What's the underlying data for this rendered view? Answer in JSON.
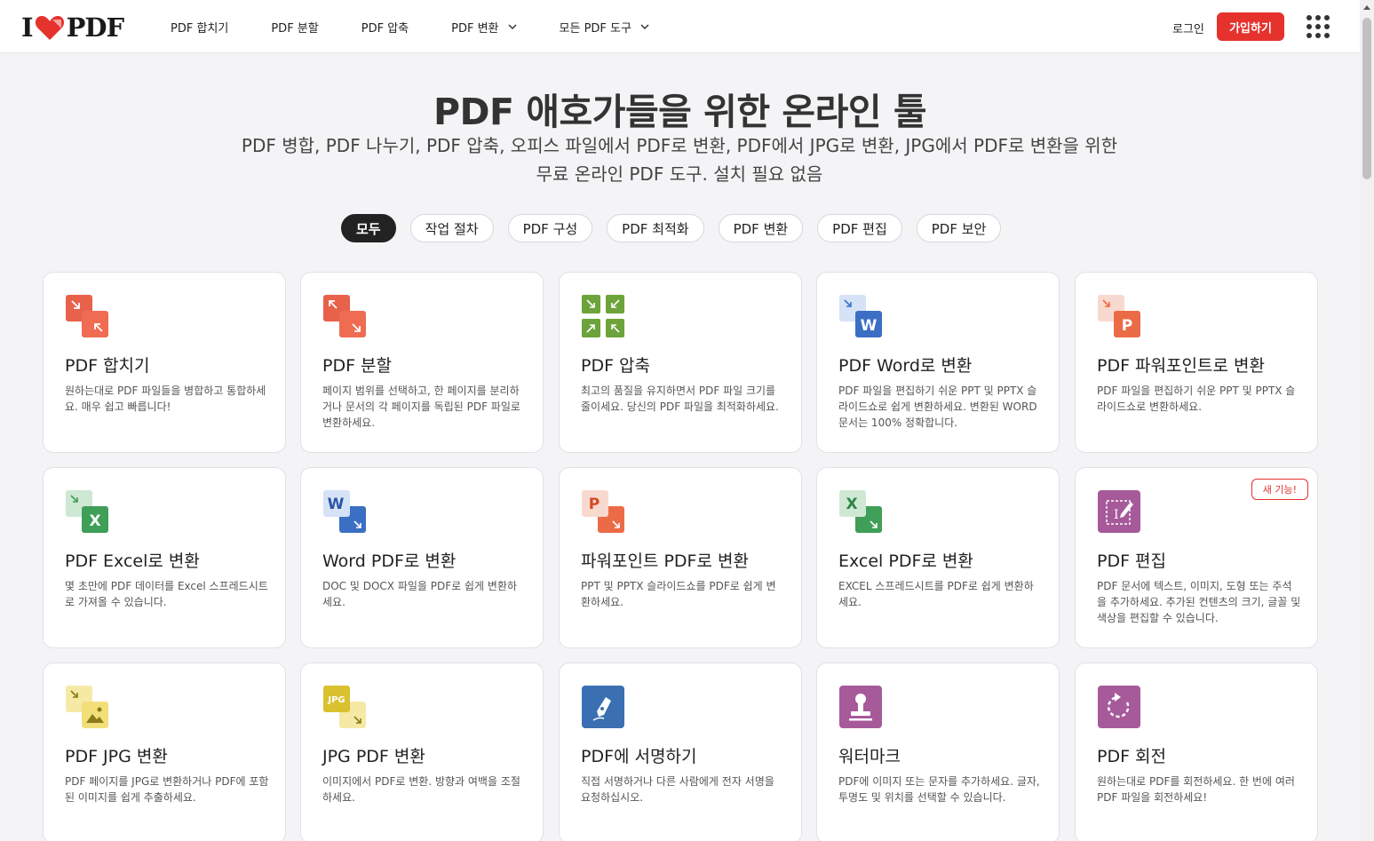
{
  "brand": {
    "logo_left": "I",
    "logo_right": "PDF",
    "color": "#e5322d"
  },
  "nav": {
    "items": [
      {
        "label": "PDF 합치기",
        "dropdown": false
      },
      {
        "label": "PDF 분할",
        "dropdown": false
      },
      {
        "label": "PDF 압축",
        "dropdown": false
      },
      {
        "label": "PDF 변환",
        "dropdown": true
      },
      {
        "label": "모든 PDF 도구",
        "dropdown": true
      }
    ],
    "login": "로그인",
    "signup": "가입하기"
  },
  "hero": {
    "title": "PDF 애호가들을 위한 온라인 툴",
    "subtitle": "PDF 병합, PDF 나누기, PDF 압축, 오피스 파일에서 PDF로 변환, PDF에서 JPG로 변환, JPG에서 PDF로 변환을 위한 무료 온라인 PDF 도구. 설치 필요 없음"
  },
  "filters": [
    {
      "label": "모두",
      "active": true
    },
    {
      "label": "작업 절차",
      "active": false
    },
    {
      "label": "PDF 구성",
      "active": false
    },
    {
      "label": "PDF 최적화",
      "active": false
    },
    {
      "label": "PDF 변환",
      "active": false
    },
    {
      "label": "PDF 편집",
      "active": false
    },
    {
      "label": "PDF 보안",
      "active": false
    }
  ],
  "tools": [
    {
      "id": "merge",
      "icon": "merge-icon",
      "title": "PDF 합치기",
      "desc": "원하는대로 PDF 파일들을 병합하고 통합하세요. 매우 쉽고 빠릅니다!"
    },
    {
      "id": "split",
      "icon": "split-icon",
      "title": "PDF 분할",
      "desc": "페이지 범위를 선택하고, 한 페이지를 분리하거나 문서의 각 페이지를 독립된 PDF 파일로 변환하세요."
    },
    {
      "id": "compress",
      "icon": "compress-icon",
      "title": "PDF 압축",
      "desc": "최고의 품질을 유지하면서 PDF 파일 크기를 줄이세요. 당신의 PDF 파일을 최적화하세요."
    },
    {
      "id": "pdf-word",
      "icon": "word-icon",
      "title": "PDF Word로 변환",
      "desc": "PDF 파일을 편집하기 쉬운 PPT 및 PPTX 슬라이드쇼로 쉽게 변환하세요. 변환된 WORD 문서는 100% 정확합니다."
    },
    {
      "id": "pdf-ppt",
      "icon": "powerpoint-icon",
      "title": "PDF 파워포인트로 변환",
      "desc": "PDF 파일을 편집하기 쉬운 PPT 및 PPTX 슬라이드쇼로 변환하세요."
    },
    {
      "id": "pdf-excel",
      "icon": "excel-icon",
      "title": "PDF Excel로 변환",
      "desc": "몇 초만에 PDF 데이터를 Excel 스프레드시트로 가져올 수 있습니다."
    },
    {
      "id": "word-pdf",
      "icon": "word-to-pdf-icon",
      "title": "Word PDF로 변환",
      "desc": "DOC 및 DOCX 파일을 PDF로 쉽게 변환하세요."
    },
    {
      "id": "ppt-pdf",
      "icon": "powerpoint-to-pdf-icon",
      "title": "파워포인트 PDF로 변환",
      "desc": "PPT 및 PPTX 슬라이드쇼를 PDF로 쉽게 변환하세요."
    },
    {
      "id": "excel-pdf",
      "icon": "excel-to-pdf-icon",
      "title": "Excel PDF로 변환",
      "desc": "EXCEL 스프레드시트를 PDF로 쉽게 변환하세요."
    },
    {
      "id": "edit",
      "icon": "edit-pdf-icon",
      "title": "PDF 편집",
      "desc": "PDF 문서에 텍스트, 이미지, 도형 또는 주석을 추가하세요. 추가된 컨텐츠의 크기, 글꼴 및 색상을 편집할 수 있습니다.",
      "badge": "새 기능!"
    },
    {
      "id": "pdf-jpg",
      "icon": "pdf-to-jpg-icon",
      "title": "PDF JPG 변환",
      "desc": "PDF 페이지를 JPG로 변환하거나 PDF에 포함된 이미지를 쉽게 추출하세요."
    },
    {
      "id": "jpg-pdf",
      "icon": "jpg-to-pdf-icon",
      "title": "JPG PDF 변환",
      "desc": "이미지에서 PDF로 변환. 방향과 여백을 조절하세요.",
      "icon_text": "JPG"
    },
    {
      "id": "sign",
      "icon": "sign-pen-icon",
      "title": "PDF에 서명하기",
      "desc": "직접 서명하거나 다른 사람에게 전자 서명을 요청하십시오."
    },
    {
      "id": "watermark",
      "icon": "watermark-stamp-icon",
      "title": "워터마크",
      "desc": "PDF에 이미지 또는 문자를 추가하세요. 글자, 투명도 및 위치를 선택할 수 있습니다."
    },
    {
      "id": "rotate",
      "icon": "rotate-icon",
      "title": "PDF 회전",
      "desc": "원하는대로 PDF를 회전하세요. 한 번에 여러 PDF 파일을 회전하세요!"
    }
  ]
}
